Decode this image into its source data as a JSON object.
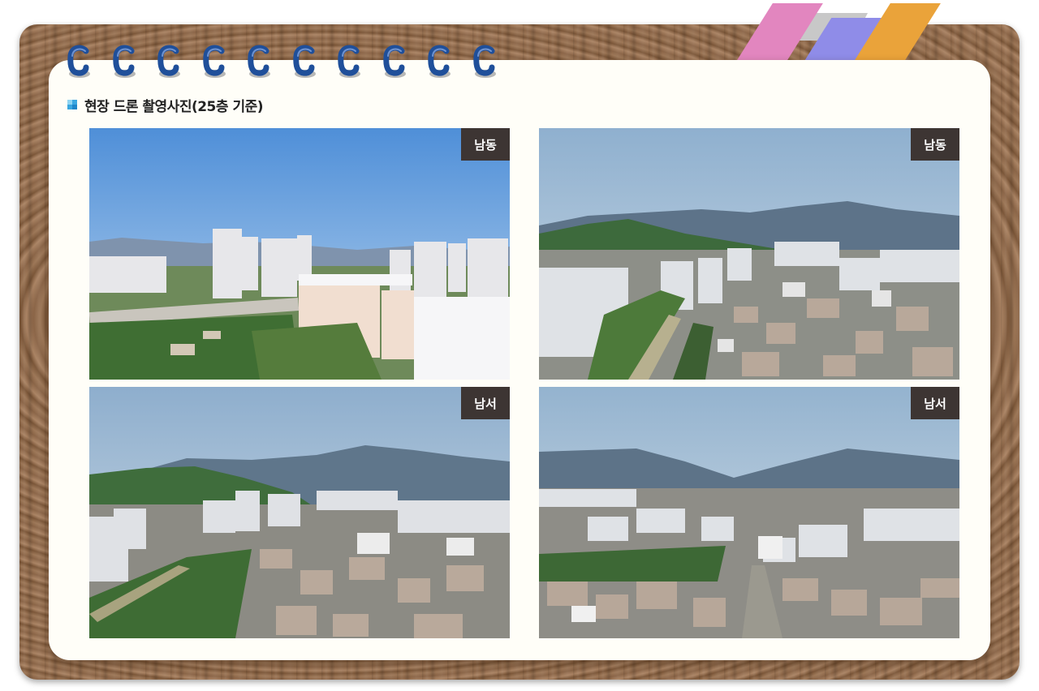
{
  "section": {
    "title": "현장 드론 촬영사진(25층 기준)",
    "icon": "blue-square-bullet-icon"
  },
  "binding": {
    "ring_count": 10,
    "ring_color": "#1f4f9a"
  },
  "tape_colors": [
    "#e286bf",
    "#8f8ce8",
    "#eaa33a",
    "#c8c8c8"
  ],
  "photos": [
    {
      "label": "남동",
      "image": "drone-aerial-apartment-complex-photo"
    },
    {
      "label": "남동",
      "image": "drone-aerial-city-and-mountains-photo"
    },
    {
      "label": "남서",
      "image": "drone-aerial-city-and-mountains-photo"
    },
    {
      "label": "남서",
      "image": "drone-aerial-city-and-mountains-photo"
    }
  ]
}
